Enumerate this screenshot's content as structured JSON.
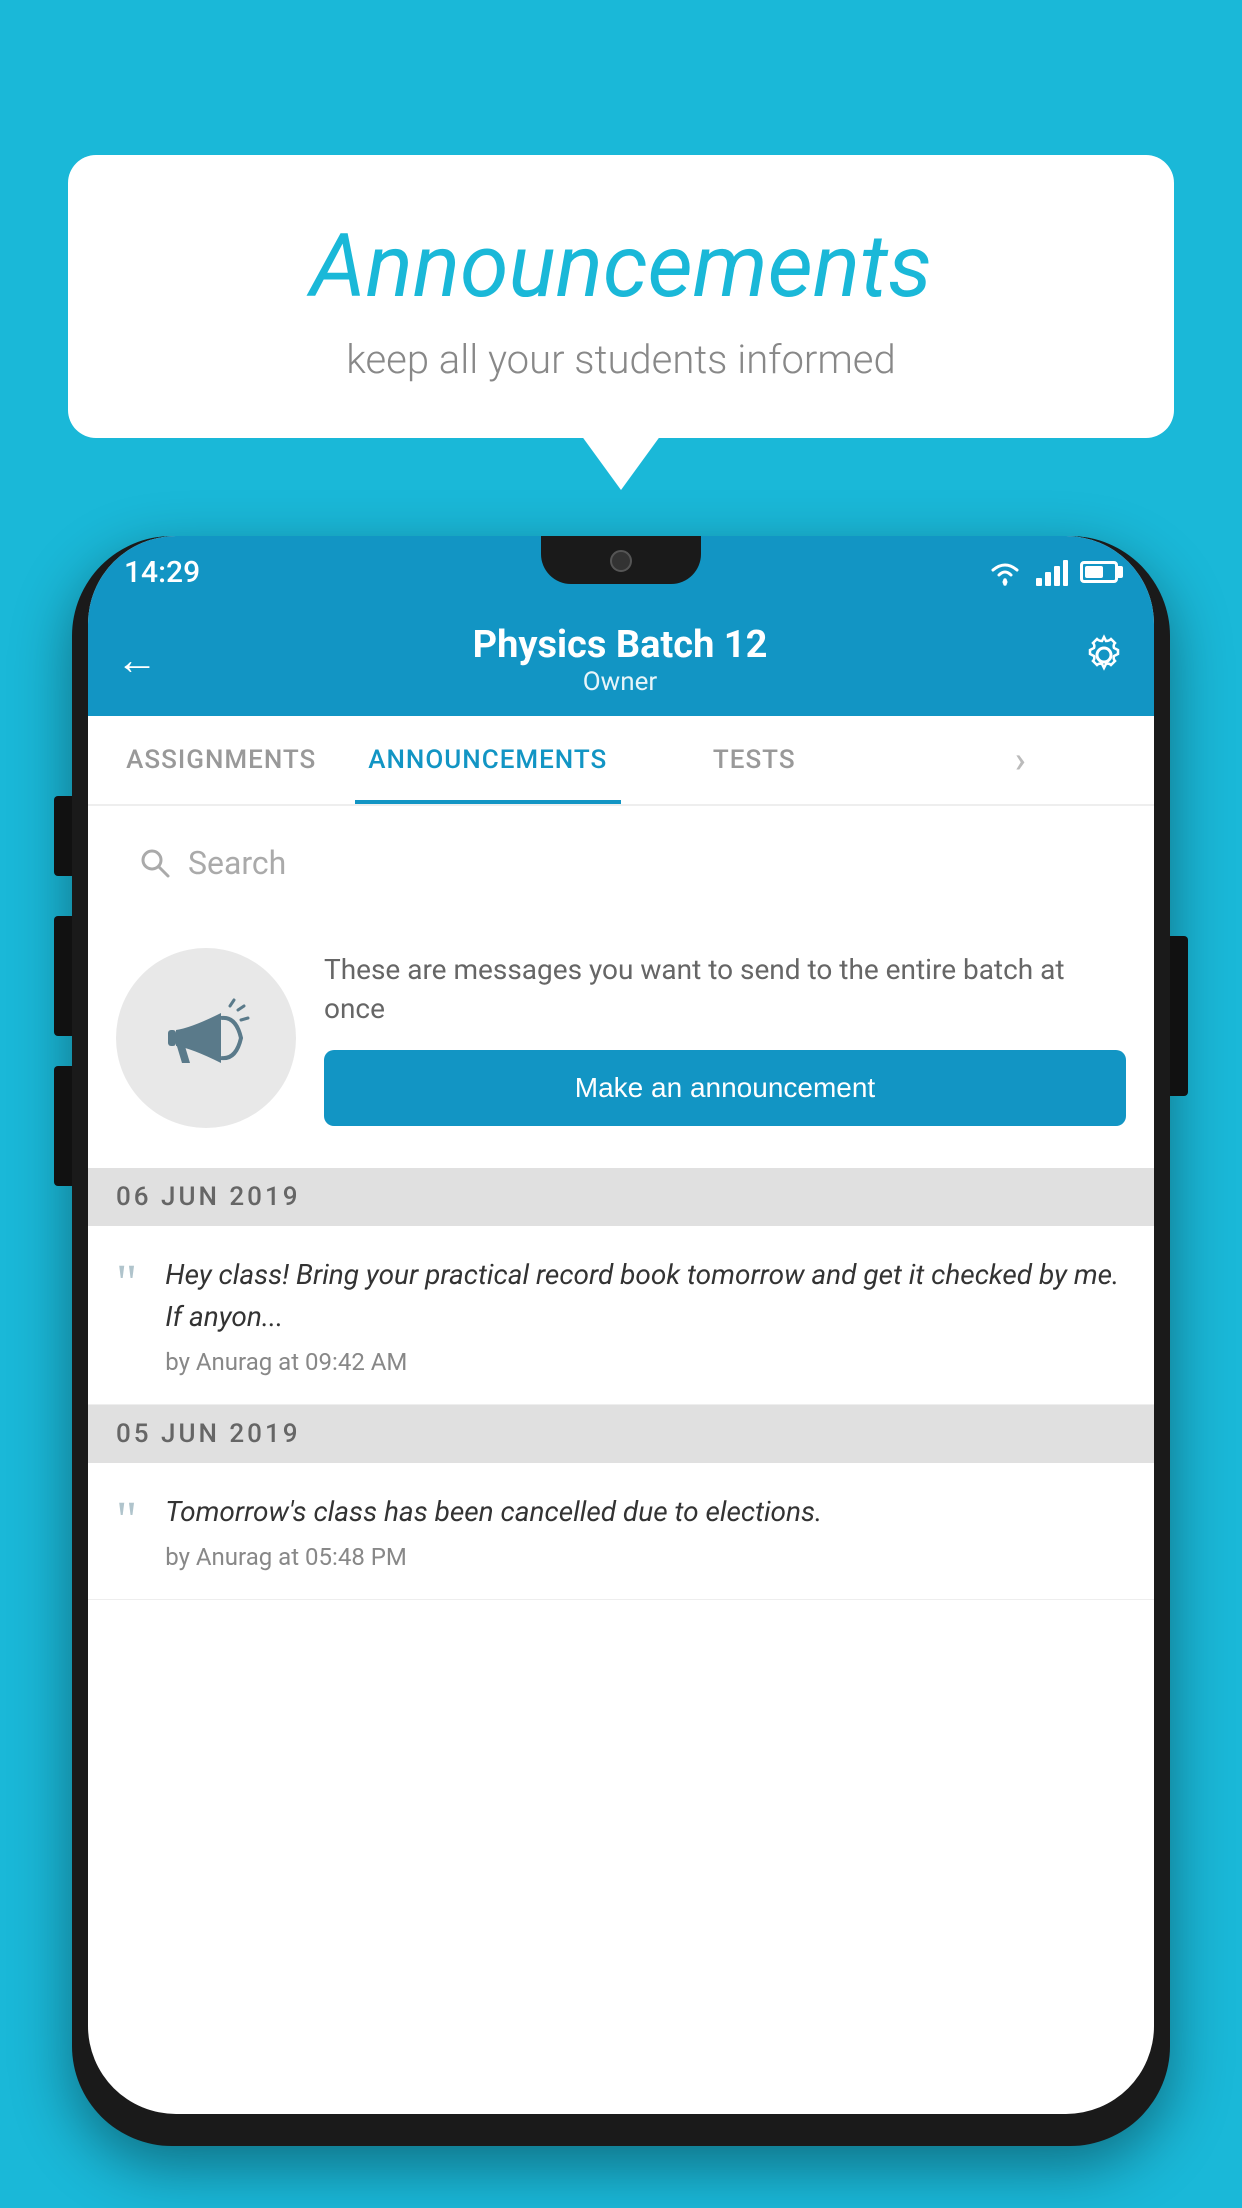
{
  "background_color": "#1ab8d8",
  "speech_bubble": {
    "title": "Announcements",
    "subtitle": "keep all your students informed"
  },
  "phone": {
    "status_bar": {
      "time": "14:29"
    },
    "header": {
      "title": "Physics Batch 12",
      "subtitle": "Owner",
      "back_label": "←"
    },
    "tabs": [
      {
        "label": "ASSIGNMENTS",
        "active": false
      },
      {
        "label": "ANNOUNCEMENTS",
        "active": true
      },
      {
        "label": "TESTS",
        "active": false
      },
      {
        "label": "",
        "active": false
      }
    ],
    "search": {
      "placeholder": "Search"
    },
    "announcement_promo": {
      "description": "These are messages you want to send to the entire batch at once",
      "button_label": "Make an announcement"
    },
    "announcements": [
      {
        "date": "06  JUN  2019",
        "message": "Hey class! Bring your practical record book tomorrow and get it checked by me. If anyon...",
        "meta": "by Anurag at 09:42 AM"
      },
      {
        "date": "05  JUN  2019",
        "message": "Tomorrow's class has been cancelled due to elections.",
        "meta": "by Anurag at 05:48 PM"
      }
    ]
  }
}
